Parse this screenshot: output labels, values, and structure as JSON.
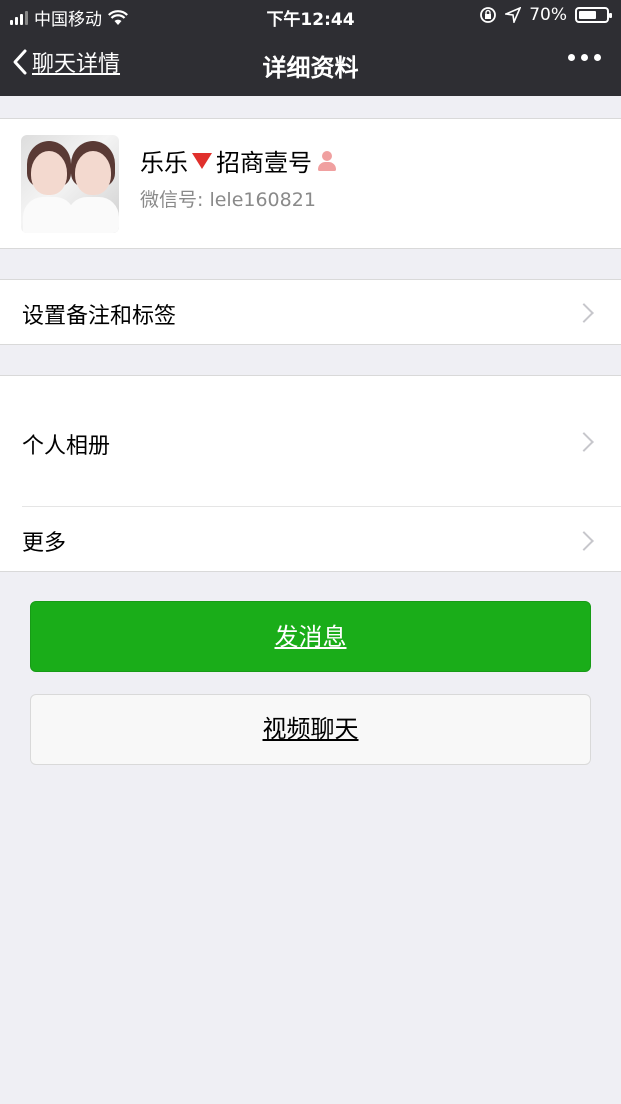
{
  "status_bar": {
    "carrier": "中国移动",
    "time": "下午12:44",
    "battery": "70%",
    "battery_level": 0.7
  },
  "nav": {
    "back_label": "聊天详情",
    "title": "详细资料"
  },
  "profile": {
    "name": "乐乐",
    "title_suffix": "招商壹号",
    "wechat_id": "微信号: lele160821"
  },
  "rows": {
    "remark": "设置备注和标签",
    "album": "个人相册",
    "more": "更多"
  },
  "buttons": {
    "send_message": "发消息",
    "video_chat": "视频聊天"
  },
  "colors": {
    "nav_bg": "#2e2e33",
    "primary_green": "#1aad19",
    "page_bg": "#efeff4"
  }
}
